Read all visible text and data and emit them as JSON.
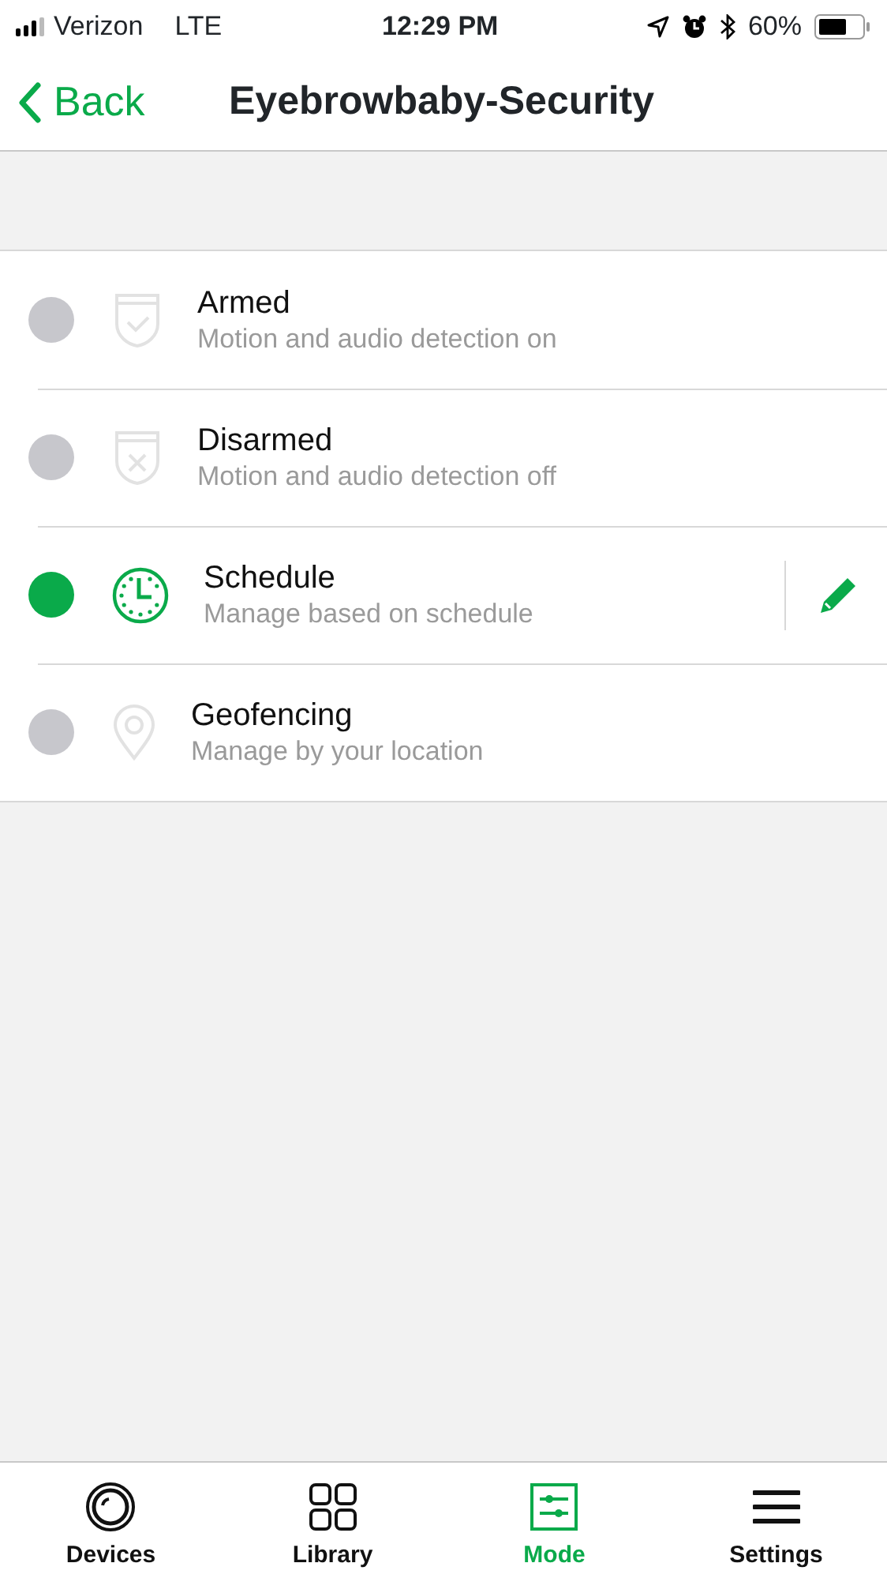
{
  "status_bar": {
    "carrier": "Verizon",
    "network": "LTE",
    "time": "12:29 PM",
    "battery_percent": "60%"
  },
  "nav_bar": {
    "back": "Back",
    "title": "Eyebrowbaby-Security"
  },
  "modes": [
    {
      "kind": "armed",
      "title": "Armed",
      "subtitle": "Motion and audio detection on",
      "selected": false
    },
    {
      "kind": "disarmed",
      "title": "Disarmed",
      "subtitle": "Motion and audio detection off",
      "selected": false
    },
    {
      "kind": "schedule",
      "title": "Schedule",
      "subtitle": "Manage based on schedule",
      "selected": true
    },
    {
      "kind": "geofencing",
      "title": "Geofencing",
      "subtitle": "Manage by your location",
      "selected": false
    }
  ],
  "tab_bar": [
    {
      "kind": "devices",
      "label": "Devices",
      "selected": false
    },
    {
      "kind": "library",
      "label": "Library",
      "selected": false
    },
    {
      "kind": "mode",
      "label": "Mode",
      "selected": true
    },
    {
      "kind": "settings",
      "label": "Settings",
      "selected": false
    }
  ]
}
